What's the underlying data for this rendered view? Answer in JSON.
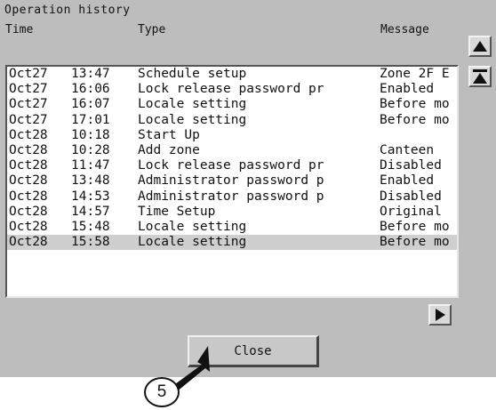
{
  "window": {
    "title": "Operation history"
  },
  "columns": {
    "time": "Time",
    "type": "Type",
    "message": "Message"
  },
  "rows": [
    {
      "date": "Oct27",
      "time": "13:47",
      "type": "Schedule setup",
      "message": "Zone 2F E",
      "selected": false
    },
    {
      "date": "Oct27",
      "time": "16:06",
      "type": "Lock release password pr",
      "message": "Enabled",
      "selected": false
    },
    {
      "date": "Oct27",
      "time": "16:07",
      "type": "Locale setting",
      "message": "Before mo",
      "selected": false
    },
    {
      "date": "Oct27",
      "time": "17:01",
      "type": "Locale setting",
      "message": "Before mo",
      "selected": false
    },
    {
      "date": "Oct28",
      "time": "10:18",
      "type": "Start Up",
      "message": "",
      "selected": false
    },
    {
      "date": "Oct28",
      "time": "10:28",
      "type": "Add zone",
      "message": "Canteen",
      "selected": false
    },
    {
      "date": "Oct28",
      "time": "11:47",
      "type": "Lock release password pr",
      "message": "Disabled",
      "selected": false
    },
    {
      "date": "Oct28",
      "time": "13:48",
      "type": "Administrator password p",
      "message": "Enabled",
      "selected": false
    },
    {
      "date": "Oct28",
      "time": "14:53",
      "type": "Administrator password p",
      "message": "Disabled",
      "selected": false
    },
    {
      "date": "Oct28",
      "time": "14:57",
      "type": "Time Setup",
      "message": "Original",
      "selected": false
    },
    {
      "date": "Oct28",
      "time": "15:48",
      "type": "Locale setting",
      "message": "Before mo",
      "selected": false
    },
    {
      "date": "Oct28",
      "time": "15:58",
      "type": "Locale setting",
      "message": "Before mo",
      "selected": true
    }
  ],
  "buttons": {
    "close": "Close"
  },
  "icons": {
    "scroll_up": "arrow-up-icon",
    "scroll_top": "arrow-top-icon",
    "scroll_right": "arrow-right-icon"
  },
  "callout": {
    "number": "5"
  },
  "colors": {
    "panel": "#bdbdbd",
    "selected_row": "#cfcfcf"
  }
}
